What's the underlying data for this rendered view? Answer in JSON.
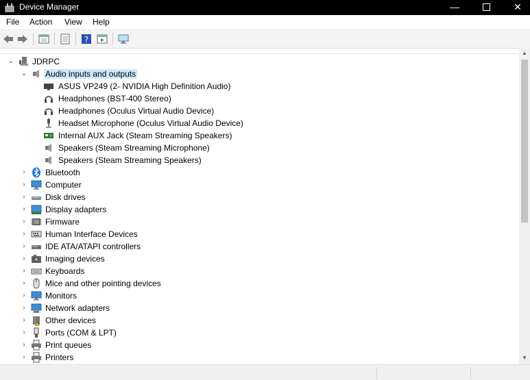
{
  "window": {
    "title": "Device Manager",
    "min": "—",
    "close": "✕"
  },
  "menu": [
    "File",
    "Action",
    "View",
    "Help"
  ],
  "toolbar": {
    "icons": [
      "back-icon",
      "forward-icon",
      "properties-icon",
      "view-icon",
      "help-icon",
      "run-icon",
      "computer-monitor-icon"
    ]
  },
  "tree": {
    "root": "JDRPC",
    "audio": {
      "label": "Audio inputs and outputs",
      "children": [
        "ASUS VP249 (2- NVIDIA High Definition Audio)",
        "Headphones (BST-400 Stereo)",
        "Headphones (Oculus Virtual Audio Device)",
        "Headset Microphone (Oculus Virtual Audio Device)",
        "Internal AUX Jack (Steam Streaming Speakers)",
        "Speakers (Steam Streaming Microphone)",
        "Speakers (Steam Streaming Speakers)"
      ]
    },
    "categories": [
      "Bluetooth",
      "Computer",
      "Disk drives",
      "Display adapters",
      "Firmware",
      "Human Interface Devices",
      "IDE ATA/ATAPI controllers",
      "Imaging devices",
      "Keyboards",
      "Mice and other pointing devices",
      "Monitors",
      "Network adapters",
      "Other devices",
      "Ports (COM & LPT)",
      "Print queues",
      "Printers"
    ]
  },
  "colors": {
    "selection": "#cce8ff",
    "titlebar": "#000000"
  }
}
